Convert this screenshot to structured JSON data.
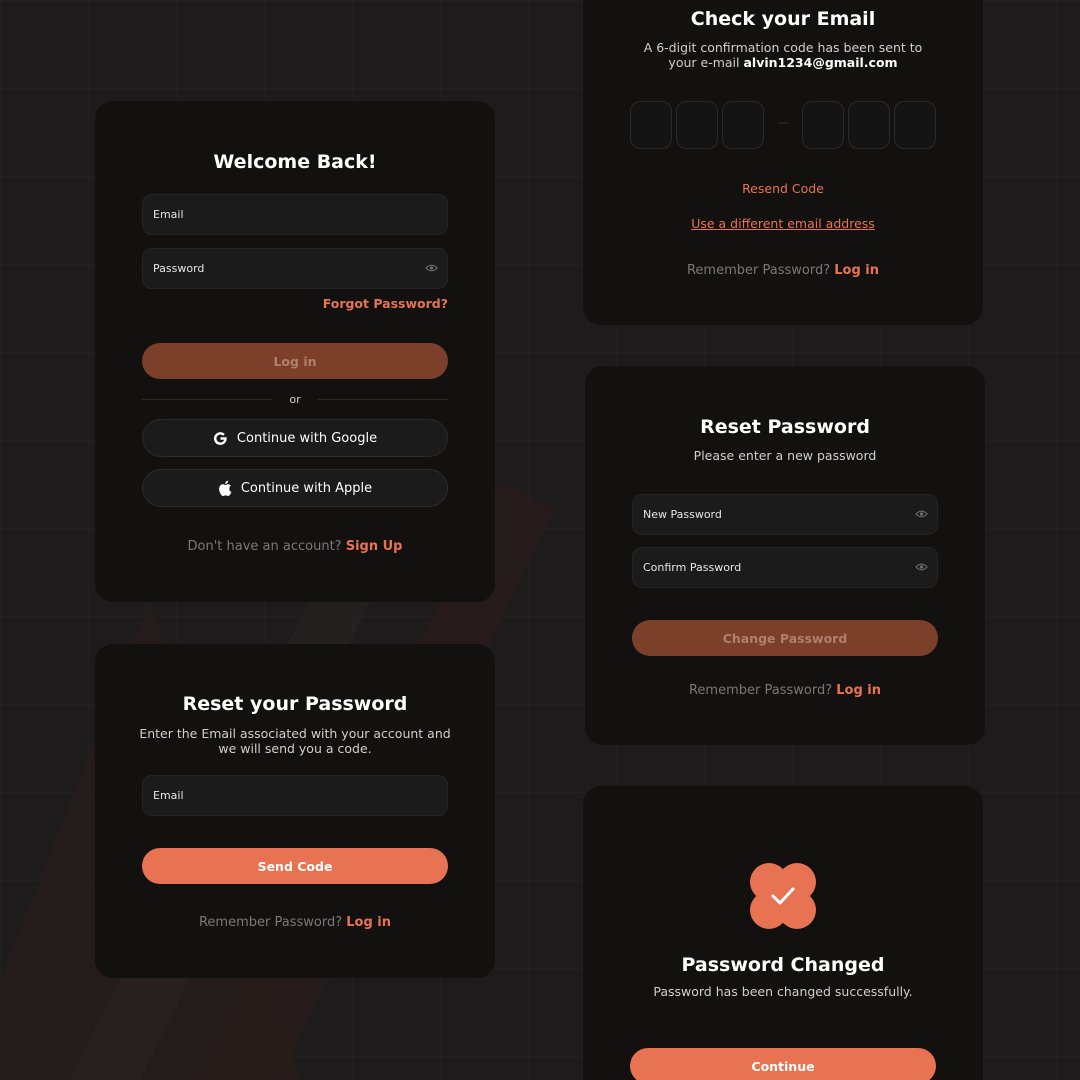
{
  "colors": {
    "background": "#1d1b1c",
    "card": "#121110",
    "accent": "#e87353",
    "accent_dim": "#7b3f2a"
  },
  "login": {
    "title": "Welcome Back!",
    "email_label": "Email",
    "password_label": "Password",
    "forgot_label": "Forgot Password?",
    "login_button": "Log in",
    "divider_label": "or",
    "google_button": "Continue with Google",
    "apple_button": "Continue with Apple",
    "signup_prompt": "Don't have an account?",
    "signup_link": "Sign Up"
  },
  "forgot": {
    "title": "Reset your Password",
    "subtitle_line1": "Enter the Email associated with your account and",
    "subtitle_line2": "we will send you a code.",
    "email_label": "Email",
    "send_button": "Send Code",
    "remember_prompt": "Remember Password?",
    "login_link": "Log in"
  },
  "verify": {
    "title": "Check your Email",
    "subtitle_line1": "A 6-digit confirmation code has been sent to",
    "subtitle_prefix": "your e-mail",
    "email": "alvin1234@gmail.com",
    "separator": "—",
    "resend_label": "Resend Code",
    "different_email_label": "Use a different email address",
    "remember_prompt": "Remember Password?",
    "login_link": "Log in"
  },
  "reset": {
    "title": "Reset Password",
    "subtitle": "Please enter a new password",
    "new_password_label": "New Password",
    "confirm_password_label": "Confirm Password",
    "change_button": "Change Password",
    "remember_prompt": "Remember Password?",
    "login_link": "Log in"
  },
  "success": {
    "icon": "check-badge-icon",
    "title": "Password Changed",
    "subtitle": "Password has been changed successfully.",
    "continue_button": "Continue"
  }
}
